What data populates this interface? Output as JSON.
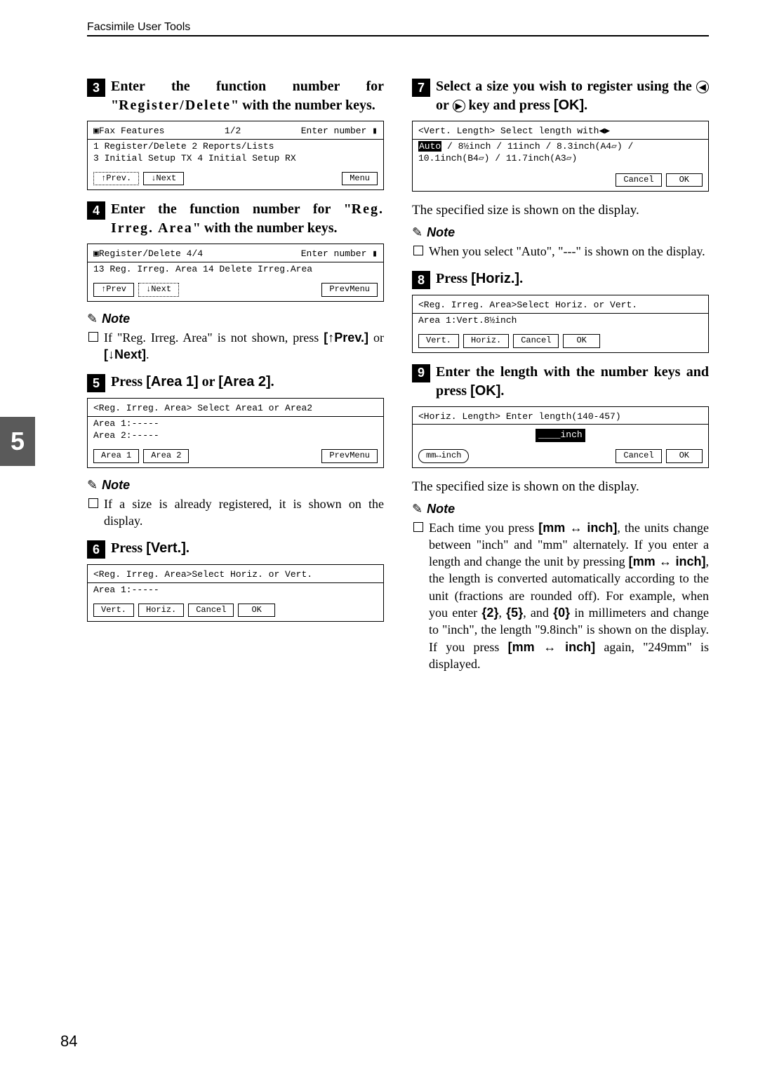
{
  "header": "Facsimile User Tools",
  "page_number": "84",
  "side_tab": "5",
  "left": {
    "step3": {
      "text_a": "Enter the function number for \"",
      "text_b": "Register/Delete",
      "text_c": "\" with the number keys."
    },
    "lcd3": {
      "line1a": "▣Fax Features",
      "line1b": "1/2",
      "line1c": "Enter number ▮",
      "line2": "1 Register/Delete   2 Reports/Lists",
      "line3": "3 Initial Setup TX  4 Initial Setup RX",
      "btn_prev": "↑Prev.",
      "btn_next": "↓Next",
      "btn_menu": "Menu"
    },
    "step4": {
      "text_a": "Enter the function number for \"",
      "text_b": "Reg. Irreg. Area",
      "text_c": "\" with the number keys."
    },
    "lcd4": {
      "line1a": "▣Register/Delete  4/4",
      "line1c": "Enter number ▮",
      "line2": "13 Reg. Irreg. Area 14 Delete Irreg.Area",
      "btn_prev": "↑Prev",
      "btn_next": "↓Next",
      "btn_menu": "PrevMenu"
    },
    "note4": {
      "label": "Note",
      "text_a": "If \"Reg. Irreg. Area\" is not shown, press ",
      "key1": "[↑Prev.]",
      "or": " or ",
      "key2": "[↓Next]",
      "dot": "."
    },
    "step5": {
      "text_a": "Press ",
      "key1": "[Area 1]",
      "or": " or ",
      "key2": "[Area 2]",
      "dot": "."
    },
    "lcd5": {
      "line1": "<Reg. Irreg. Area> Select Area1 or Area2",
      "line2": "Area 1:-----",
      "line3": "Area 2:-----",
      "btn1": "Area 1",
      "btn2": "Area 2",
      "btn_menu": "PrevMenu"
    },
    "note5": {
      "label": "Note",
      "text": "If a size is already registered, it is shown on the display."
    },
    "step6": {
      "text_a": "Press ",
      "key1": "[Vert.]",
      "dot": "."
    },
    "lcd6": {
      "line1": "<Reg. Irreg. Area>Select Horiz. or Vert.",
      "line2": "Area 1:-----",
      "btn1": "Vert.",
      "btn2": "Horiz.",
      "btn3": "Cancel",
      "btn4": "OK"
    }
  },
  "right": {
    "step7": {
      "text_a": "Select a size you wish to register using the ",
      "text_b": " or ",
      "text_c": " key and press ",
      "key1": "[OK]",
      "dot": "."
    },
    "lcd7": {
      "line1": "<Vert. Length>    Select length with◀▶",
      "line2a": "Auto",
      "line2b": " / 8½inch / 11inch / 8.3inch(A4▱) /",
      "line3": "10.1inch(B4▱) / 11.7inch(A3▱)",
      "btn1": "Cancel",
      "btn2": "OK"
    },
    "body7": "The specified size is shown on the display.",
    "note7": {
      "label": "Note",
      "text": "When you select \"Auto\", \"---\" is shown on the display."
    },
    "step8": {
      "text_a": "Press ",
      "key1": "[Horiz.]",
      "dot": "."
    },
    "lcd8": {
      "line1": "<Reg. Irreg. Area>Select Horiz. or Vert.",
      "line2": "Area 1:Vert.8½inch",
      "btn1": "Vert.",
      "btn2": "Horiz.",
      "btn3": "Cancel",
      "btn4": "OK"
    },
    "step9": {
      "text_a": "Enter the length with the number keys and press ",
      "key1": "[OK]",
      "dot": "."
    },
    "lcd9": {
      "line1": "<Horiz. Length>    Enter length(140-457)",
      "input": "____inch",
      "btn1": "mm↔inch",
      "btn2": "Cancel",
      "btn3": "OK"
    },
    "body9": "The specified size is shown on the display.",
    "note9": {
      "label": "Note",
      "text_a": "Each time you press ",
      "key1": "[mm ↔ inch]",
      "text_b": ", the units change between \"inch\" and \"mm\" alternately. If you enter a length and change the unit by pressing ",
      "key2": "[mm ↔ inch]",
      "text_c": ", the length is converted automatically according to the unit (fractions are rounded off). For example, when you enter ",
      "num2": "{2}",
      "c1": ", ",
      "num5": "{5}",
      "c2": ", and ",
      "num0": "{0}",
      "text_d": " in millimeters and change to \"inch\", the length \"9.8inch\" is shown on the display. If you press ",
      "key3": "[mm ↔ inch]",
      "text_e": " again, \"249mm\" is displayed."
    }
  }
}
